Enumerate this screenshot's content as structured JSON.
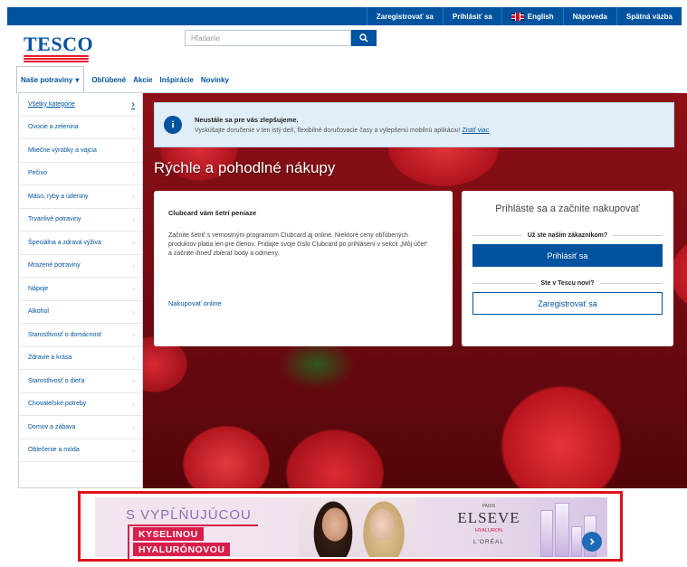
{
  "topbar": {
    "register": "Zaregistrovať sa",
    "signin": "Prihlásiť sa",
    "language": "English",
    "help": "Nápoveda",
    "contact": "Spätná väzba"
  },
  "header": {
    "logo": "TESCO",
    "search_placeholder": "Hľadanie"
  },
  "nav": {
    "items": [
      {
        "label": "Naše potraviny"
      },
      {
        "label": "Obľúbené"
      },
      {
        "label": "Akcie"
      },
      {
        "label": "Inšpirácie"
      },
      {
        "label": "Novinky"
      }
    ]
  },
  "sidebar": {
    "items": [
      {
        "label": "Všetky kategórie"
      },
      {
        "label": "Ovocie a zelenina"
      },
      {
        "label": "Mliečne výrobky a vajcia"
      },
      {
        "label": "Pečivo"
      },
      {
        "label": "Mäso, ryby a údeniny"
      },
      {
        "label": "Trvanlivé potraviny"
      },
      {
        "label": "Špeciálna a zdravá výživa"
      },
      {
        "label": "Mrazené potraviny"
      },
      {
        "label": "Nápoje"
      },
      {
        "label": "Alkohol"
      },
      {
        "label": "Starostlivosť o domácnosť"
      },
      {
        "label": "Zdravie a krása"
      },
      {
        "label": "Starostlivosť o dieťa"
      },
      {
        "label": "Chovateľské potreby"
      },
      {
        "label": "Domov a zábava"
      },
      {
        "label": "Oblečenie a móda"
      }
    ]
  },
  "notice": {
    "title": "Neustále sa pre vás zlepšujeme.",
    "text": "Vyskúšajte doručenie v ten istý deň, flexibilné doručovacie časy a vylepšenú mobilnú aplikáciu!",
    "link": "Zistiť viac"
  },
  "hero": {
    "title": "Rýchle a pohodlné nákupy"
  },
  "clubcard": {
    "title": "Clubcard vám šetrí peniaze",
    "text": "Začnite šetriť s vernostným programom Clubcard aj online. Niektoré ceny obľúbených produktov platia len pre členov. Pridajte svoje číslo Clubcard po prihlásení v sekcii „Môj účet“ a začnite ihneď zbierať body a odmeny.",
    "link": "Nakupovať online"
  },
  "login": {
    "title": "Prihláste sa a začnite nakupovať",
    "existing_label": "Už ste naším zákazníkom?",
    "signin_button": "Prihlásiť sa",
    "new_label": "Ste v Tescu noví?",
    "register_button": "Zaregistrovať sa"
  },
  "ad": {
    "line1": "S VYPĹŇUJÚCOU",
    "line2": "KYSELINOU",
    "line3": "HYALURÓNOVOU",
    "brand_top": "PARIS",
    "brand": "ELSEVE",
    "brand_sub": "HYALURON",
    "brand_bottom": "L'ORÉAL"
  }
}
